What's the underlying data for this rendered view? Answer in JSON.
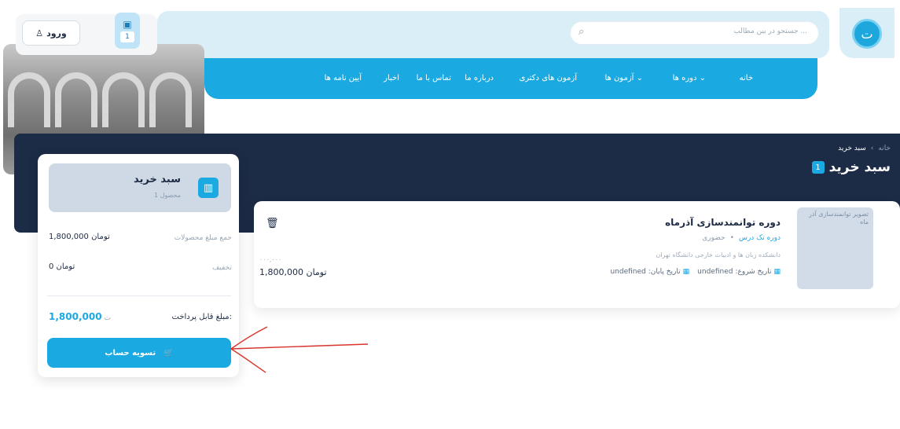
{
  "header": {
    "search_placeholder": "جستجو در بین مطالب ...",
    "login_label": "ورود",
    "cart_count": "1",
    "logo_text": "ت"
  },
  "nav": {
    "items": [
      {
        "label": "خانه"
      },
      {
        "label": "دوره ها ⌄"
      },
      {
        "label": "آزمون ها ⌄"
      },
      {
        "label": "آزمون های دکتری"
      },
      {
        "label": "درباره ما"
      },
      {
        "label": "تماس با ما"
      },
      {
        "label": "اخبار"
      },
      {
        "label": "آیین نامه ها"
      }
    ]
  },
  "breadcrumb": {
    "home": "خانه",
    "separator": "›",
    "current": "سبد خرید"
  },
  "page": {
    "title": "سبد خرید",
    "badge": "1"
  },
  "summary": {
    "title": "سبد خرید",
    "subtitle": "1 محصول",
    "subtotal_label": "جمع مبلغ محصولات",
    "subtotal_value": "1,800,000 تومان",
    "discount_label": "تخفیف",
    "discount_value": "0 تومان",
    "payable_label": "مبلغ قابل پرداخت:",
    "payable_value": "1,800,000",
    "payable_currency": "ت",
    "checkout_label": "تسویه حساب"
  },
  "course": {
    "thumb_text": "تصویر توانمندسازی آذر ماه",
    "title": "دوره توانمندسازی آذرماه",
    "type": "دوره تک درس",
    "type_separator": "•",
    "type_status": "حضوری",
    "org": "دانشکده زبان ها و ادبیات خارجی دانشگاه تهران",
    "start_label": "تاریخ شروع:",
    "start_value": "undefined",
    "end_label": "تاریخ پایان:",
    "end_value": "undefined",
    "old_price": "۰۰۰,۰۰۰",
    "price": "1,800,000 تومان"
  },
  "colors": {
    "accent": "#1aa9e1",
    "dark": "#1c2b46",
    "light": "#d9eef7"
  }
}
